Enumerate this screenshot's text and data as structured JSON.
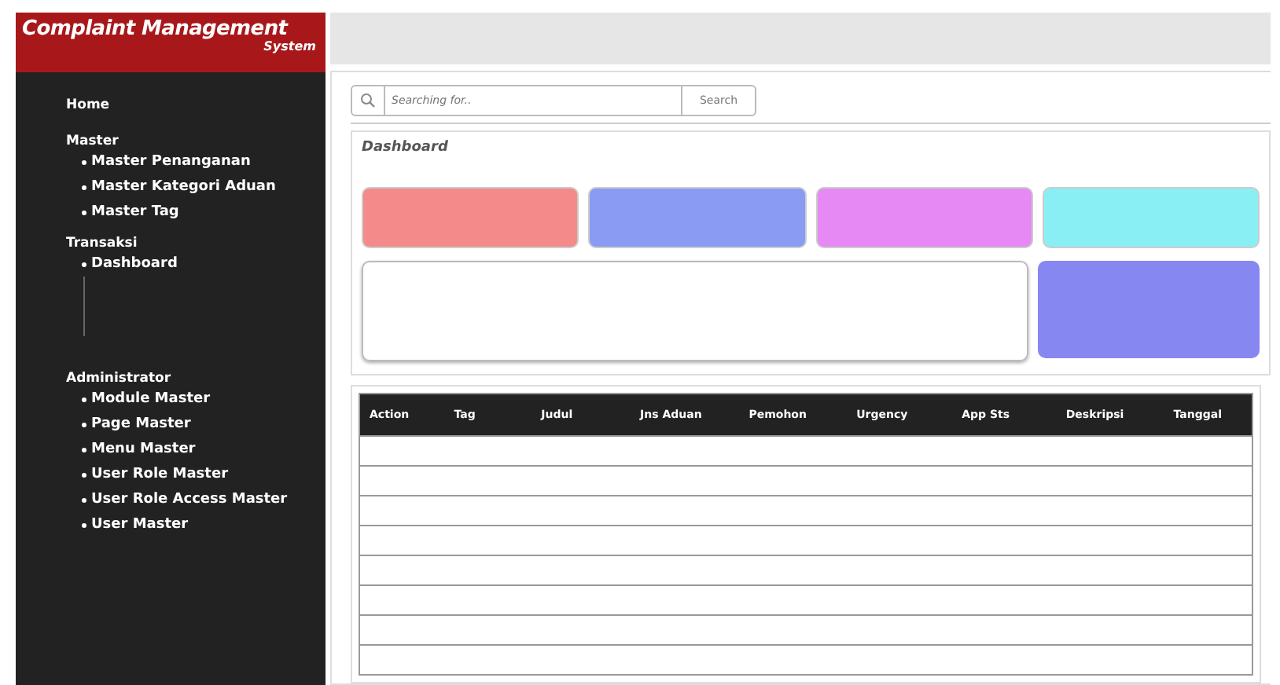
{
  "brand": {
    "title": "Complaint Management",
    "subtitle": "System"
  },
  "sidebar": {
    "sections": [
      {
        "label": "Home"
      },
      {
        "label": "Master",
        "items": [
          "Master Penanganan",
          "Master Kategori Aduan",
          "Master Tag"
        ]
      },
      {
        "label": "Transaksi",
        "items": [
          "Dashboard"
        ]
      },
      {
        "label": "Administrator",
        "items": [
          "Module Master",
          "Page Master",
          "Menu Master",
          "User Role Master",
          "User Role Access Master",
          "User Master"
        ]
      }
    ]
  },
  "search": {
    "placeholder": "Searching for..",
    "button": "Search"
  },
  "dashboard": {
    "title": "Dashboard",
    "cards": [
      {
        "color": "#f48a8a"
      },
      {
        "color": "#8a9bf4"
      },
      {
        "color": "#e689f4"
      },
      {
        "color": "#8aeff4"
      }
    ],
    "side_card": {
      "color": "#8787f2"
    }
  },
  "table": {
    "columns": [
      "Action",
      "Tag",
      "Judul",
      "Jns Aduan",
      "Pemohon",
      "Urgency",
      "App Sts",
      "Deskripsi",
      "Tanggal"
    ]
  }
}
